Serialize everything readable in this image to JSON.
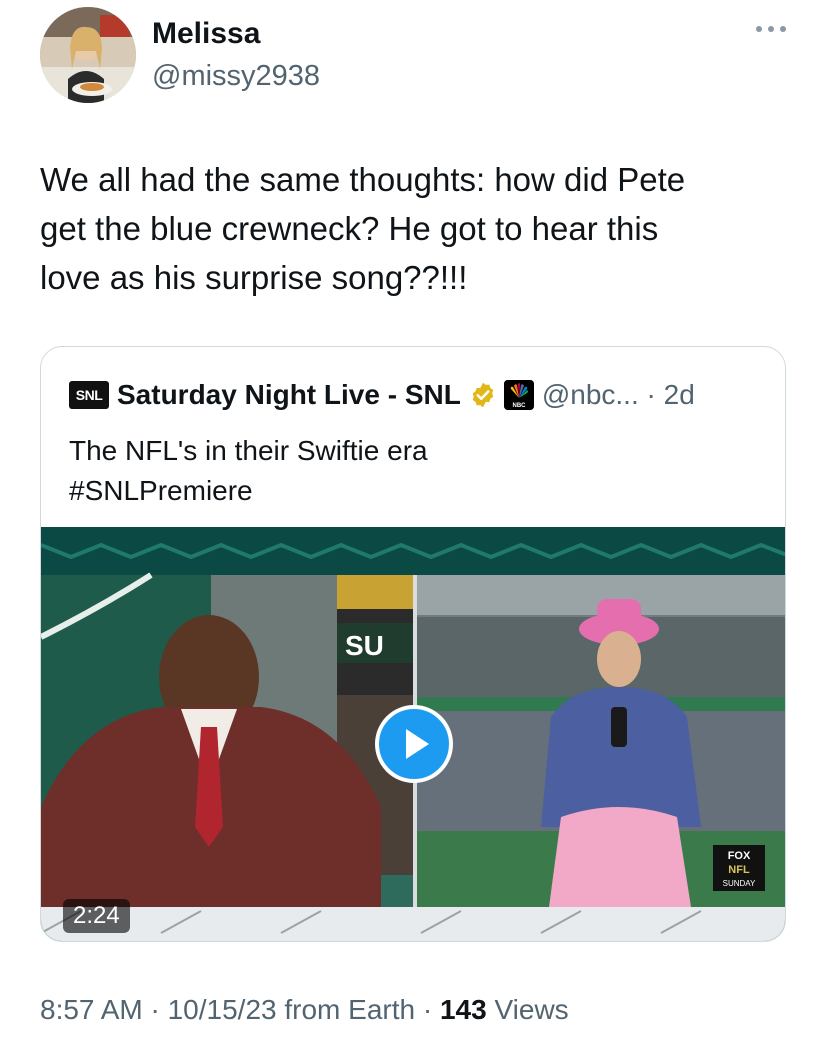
{
  "author": {
    "name": "Melissa",
    "handle": "@missy2938",
    "avatar_icon": "avatar"
  },
  "tweet": {
    "lines": [
      "We all had the same thoughts: how did Pete",
      "get the blue crewneck?  He got to hear this",
      "love as his surprise song??!!!"
    ]
  },
  "quote": {
    "logo_text": "SNL",
    "name": "Saturday Night Live - SNL",
    "handle_time": "@nbc... · 2d",
    "lines": [
      "The NFL's in their Swiftie era",
      "#SNLPremiere"
    ],
    "video": {
      "duration": "2:24",
      "overlay_sign": "SU",
      "broadcast_bug": "FOX NFL SUNDAY"
    }
  },
  "footer": {
    "time_date": "8:57 AM · 10/15/23 from Earth · ",
    "views_count": "143",
    "views_label": " Views"
  },
  "colors": {
    "accent": "#1d9bf0",
    "secondary_text": "#536471",
    "border": "#cfd9de",
    "verified_gold": "#e2b719"
  }
}
